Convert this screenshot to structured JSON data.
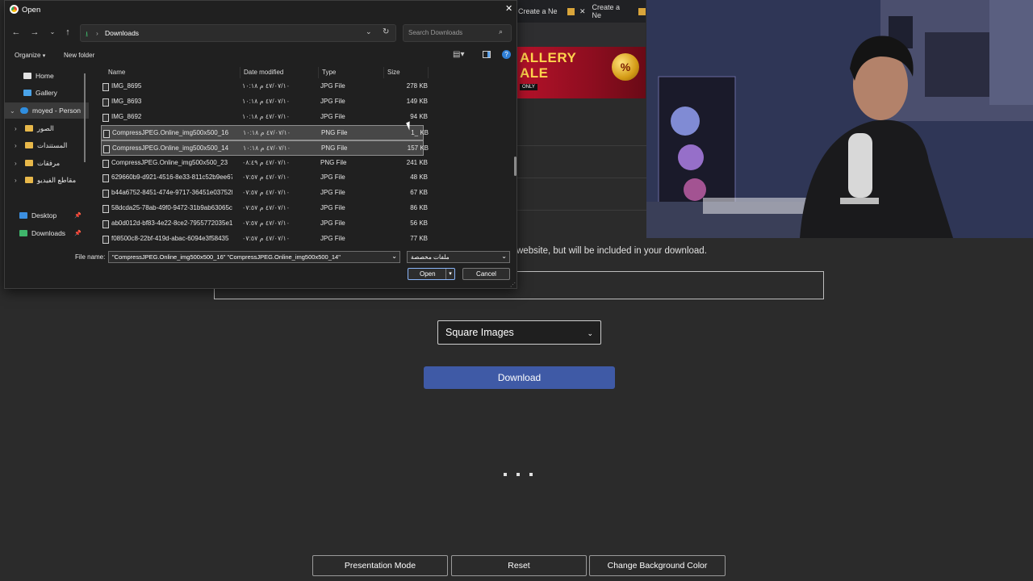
{
  "browser_behind": {
    "tabs": [
      "Create a Ne",
      "Create a Ne"
    ],
    "banner": {
      "line1": "ALLERY",
      "line2": "ALE",
      "tag": "ONLY",
      "coin": "%"
    },
    "hint_text": "website, but will be included in your download.",
    "square_select": "Square Images",
    "download_button": "Download",
    "bottom_buttons": [
      "Presentation Mode",
      "Reset",
      "Change Background Color"
    ]
  },
  "dialog": {
    "title": "Open",
    "address": "Downloads",
    "search_placeholder": "Search Downloads",
    "organize": "Organize",
    "new_folder": "New folder",
    "nav": [
      {
        "label": "Home",
        "icon": "home-icon",
        "color": "#e3e3e3"
      },
      {
        "label": "Gallery",
        "icon": "gallery-icon",
        "color": "#4aa3e8"
      },
      {
        "label": "moyed - Person",
        "icon": "cloud-icon",
        "color": "#2f8ee0"
      },
      {
        "label": "الصور",
        "icon": "folder-icon",
        "color": "#e8b84a"
      },
      {
        "label": "المستندات",
        "icon": "folder-icon",
        "color": "#e8b84a"
      },
      {
        "label": "مرفقات",
        "icon": "folder-icon",
        "color": "#e8b84a"
      },
      {
        "label": "مقاطع الفيديو",
        "icon": "folder-icon",
        "color": "#e8b84a"
      },
      {
        "label": "Desktop",
        "icon": "desktop-icon",
        "color": "#3c8fe0"
      },
      {
        "label": "Downloads",
        "icon": "download-icon",
        "color": "#3fb66b"
      }
    ],
    "columns": [
      "Name",
      "Date modified",
      "Type",
      "Size"
    ],
    "files": [
      {
        "name": "IMG_8695",
        "date": "٤٧/٠٧/١٠ م ١٠:١٨",
        "type": "JPG File",
        "size": "278 KB"
      },
      {
        "name": "IMG_8693",
        "date": "٤٧/٠٧/١٠ م ١٠:١٨",
        "type": "JPG File",
        "size": "149 KB"
      },
      {
        "name": "IMG_8692",
        "date": "٤٧/٠٧/١٠ م ١٠:١٨",
        "type": "JPG File",
        "size": "94 KB"
      },
      {
        "name": "CompressJPEG.Online_img500x500_16",
        "date": "٤٧/٠٧/١٠ م ١٠:١٨",
        "type": "PNG File",
        "size": "1_ KB",
        "selected": true
      },
      {
        "name": "CompressJPEG.Online_img500x500_14",
        "date": "٤٧/٠٧/١٠ م ١٠:١٨",
        "type": "PNG File",
        "size": "157 KB",
        "selected": true
      },
      {
        "name": "CompressJPEG.Online_img500x500_23",
        "date": "٤٧/٠٧/١٠ م ٠٨:٤٩",
        "type": "PNG File",
        "size": "241 KB"
      },
      {
        "name": "629660b9-d921-4516-8e33-811c52b9ee67",
        "date": "٤٧/٠٧/١٠ م ٠٧:٥٧",
        "type": "JPG File",
        "size": "48 KB"
      },
      {
        "name": "b44a6752-8451-474e-9717-36451e03752f",
        "date": "٤٧/٠٧/١٠ م ٠٧:٥٧",
        "type": "JPG File",
        "size": "67 KB"
      },
      {
        "name": "58dcda25-78ab-49f0-9472-31b9ab63065c",
        "date": "٤٧/٠٧/١٠ م ٠٧:٥٧",
        "type": "JPG File",
        "size": "86 KB"
      },
      {
        "name": "ab0d012d-bf83-4e22-8ce2-7955772035e1",
        "date": "٤٧/٠٧/١٠ م ٠٧:٥٧",
        "type": "JPG File",
        "size": "56 KB"
      },
      {
        "name": "f08500c8-22bf-419d-abac-6094e3f58435",
        "date": "٤٧/٠٧/١٠ م ٠٧:٥٧",
        "type": "JPG File",
        "size": "77 KB"
      }
    ],
    "file_name_label": "File name:",
    "file_name_value": "\"CompressJPEG.Online_img500x500_16\" \"CompressJPEG.Online_img500x500_14\"",
    "file_type": "ملفات مخصصة",
    "open_button": "Open",
    "cancel_button": "Cancel"
  },
  "colors": {
    "dialog_bg": "#202020",
    "accent_blue": "#3f5aa6",
    "selection": "#474747"
  }
}
